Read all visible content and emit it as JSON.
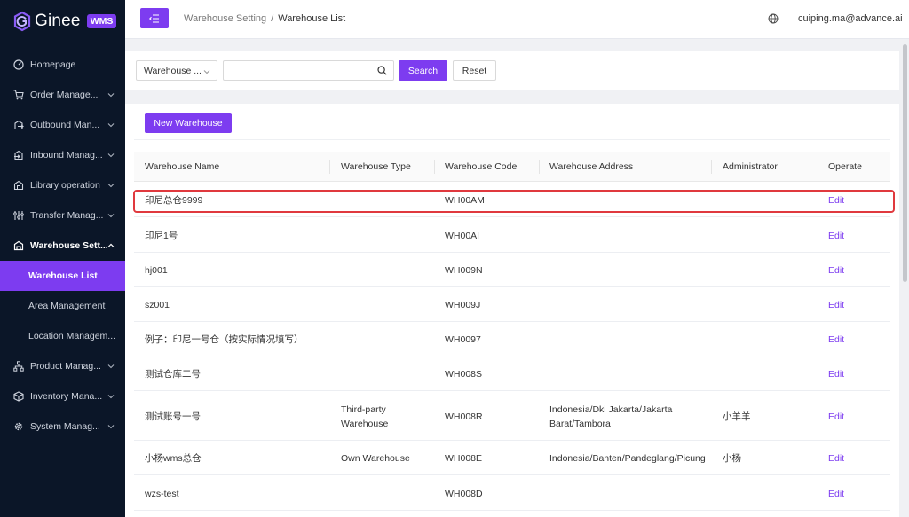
{
  "app": {
    "brand": "Ginee",
    "badge": "WMS"
  },
  "sidebar": {
    "items": [
      {
        "label": "Homepage",
        "icon": "dashboard-icon"
      },
      {
        "label": "Order Manage...",
        "icon": "cart-icon"
      },
      {
        "label": "Outbound Man...",
        "icon": "outbound-icon"
      },
      {
        "label": "Inbound Manag...",
        "icon": "inbound-icon"
      },
      {
        "label": "Library operation",
        "icon": "library-icon"
      },
      {
        "label": "Transfer Manag...",
        "icon": "transfer-icon"
      },
      {
        "label": "Warehouse Sett...",
        "icon": "warehouse-icon"
      },
      {
        "label": "Product Manag...",
        "icon": "product-icon"
      },
      {
        "label": "Inventory Mana...",
        "icon": "inventory-icon"
      },
      {
        "label": "System Manag...",
        "icon": "gear-icon"
      }
    ],
    "subitems": [
      {
        "label": "Warehouse List"
      },
      {
        "label": "Area Management"
      },
      {
        "label": "Location Managem..."
      }
    ]
  },
  "header": {
    "breadcrumb_parent": "Warehouse Setting",
    "breadcrumb_sep": "/",
    "breadcrumb_current": "Warehouse List",
    "user": "cuiping.ma@advance.ai"
  },
  "filter": {
    "select_value": "Warehouse ...",
    "search_value": "",
    "search_label": "Search",
    "reset_label": "Reset"
  },
  "list": {
    "new_label": "New Warehouse",
    "columns": [
      "Warehouse Name",
      "Warehouse Type",
      "Warehouse Code",
      "Warehouse Address",
      "Administrator",
      "Operate"
    ],
    "rows": [
      {
        "name": "印尼总仓9999",
        "type": "",
        "code": "WH00AM",
        "address": "",
        "admin": "",
        "op": "Edit"
      },
      {
        "name": "印尼1号",
        "type": "",
        "code": "WH00AI",
        "address": "",
        "admin": "",
        "op": "Edit"
      },
      {
        "name": "hj001",
        "type": "",
        "code": "WH009N",
        "address": "",
        "admin": "",
        "op": "Edit"
      },
      {
        "name": "sz001",
        "type": "",
        "code": "WH009J",
        "address": "",
        "admin": "",
        "op": "Edit"
      },
      {
        "name": "例子：印尼一号仓（按实际情况填写）",
        "type": "",
        "code": "WH0097",
        "address": "",
        "admin": "",
        "op": "Edit"
      },
      {
        "name": "测试仓库二号",
        "type": "",
        "code": "WH008S",
        "address": "",
        "admin": "",
        "op": "Edit"
      },
      {
        "name": "测试账号一号",
        "type_line1": "Third-party",
        "type_line2": "Warehouse",
        "code": "WH008R",
        "address_line1": "Indonesia/Dki Jakarta/Jakarta",
        "address_line2": "Barat/Tambora",
        "admin": "小羊羊",
        "op": "Edit"
      },
      {
        "name": "小杨wms总仓",
        "type": "Own Warehouse",
        "code": "WH008E",
        "address": "Indonesia/Banten/Pandeglang/Picung",
        "admin": "小杨",
        "op": "Edit"
      },
      {
        "name": "wzs-test",
        "type": "",
        "code": "WH008D",
        "address": "",
        "admin": "",
        "op": "Edit"
      }
    ]
  },
  "colors": {
    "accent": "#7d3cf0",
    "sidebar_bg": "#0b1628",
    "highlight": "#e0393e"
  }
}
